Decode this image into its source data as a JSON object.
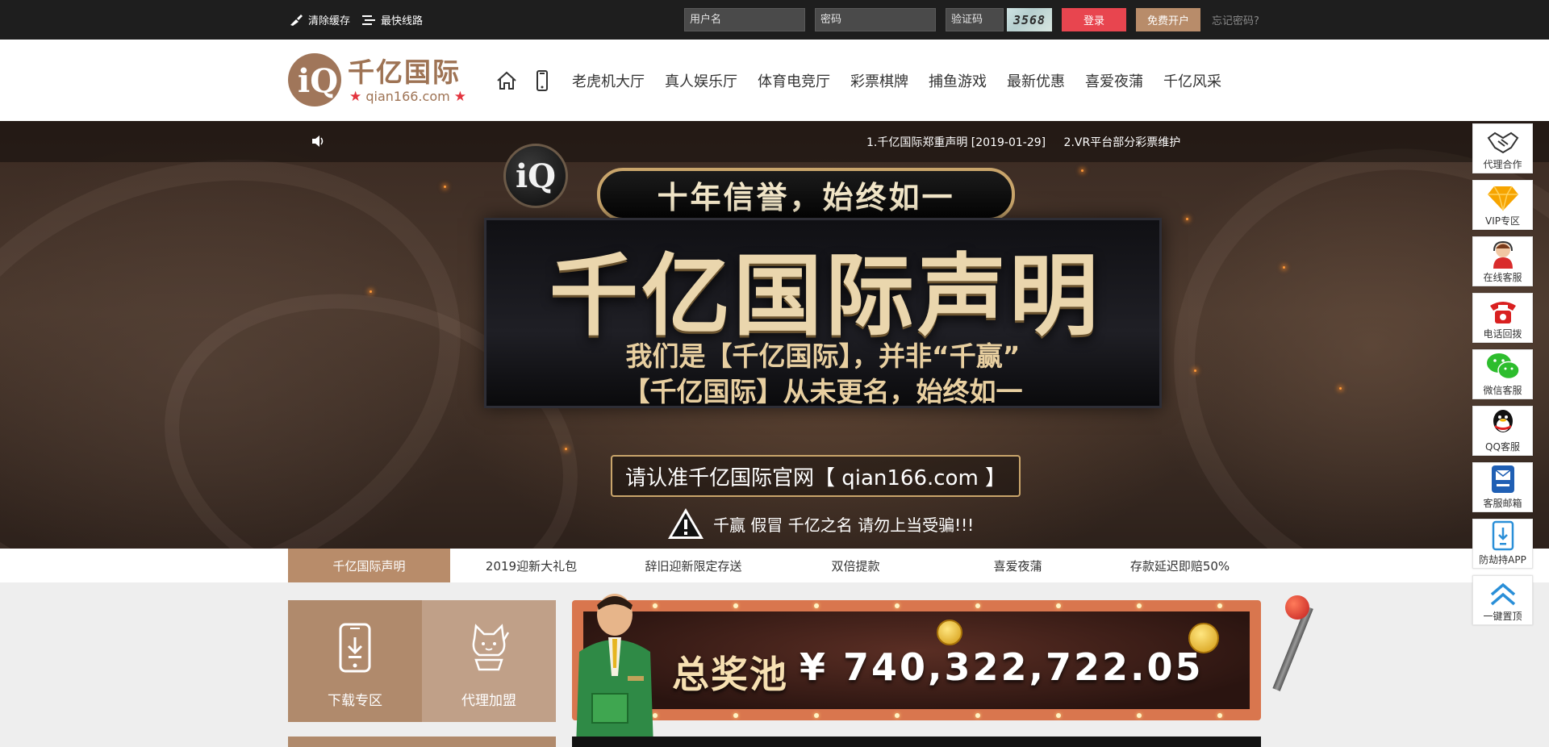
{
  "topbar": {
    "clear_cache": "清除缓存",
    "fastest_route": "最快线路",
    "username_placeholder": "用户名",
    "password_placeholder": "密码",
    "captcha_placeholder": "验证码",
    "captcha_code": "3568",
    "login_label": "登录",
    "register_label": "免费开户",
    "forgot_label": "忘记密码?"
  },
  "header": {
    "logo_name": "千亿国际",
    "logo_domain": "qian166.com",
    "nav": [
      "老虎机大厅",
      "真人娱乐厅",
      "体育电竞厅",
      "彩票棋牌",
      "捕鱼游戏",
      "最新优惠",
      "喜爱夜蒲",
      "千亿风采"
    ]
  },
  "banner": {
    "notices": [
      "1.千亿国际郑重声明 [2019-01-29]",
      "2.VR平台部分彩票维护"
    ],
    "hero_logo": "iQ",
    "hero_top": "十年信誉，始终如一",
    "hero_title": "千亿国际声明",
    "hero_sub_1": "我们是【千亿国际】，并非“千赢”",
    "hero_sub_2": "【千亿国际】从未更名，始终如一",
    "hero_url": "请认准千亿国际官网【 qian166.com 】",
    "hero_warn": "千赢 假冒 千亿之名 请勿上当受骗!!!"
  },
  "tabs": [
    {
      "label": "千亿国际声明",
      "active": true
    },
    {
      "label": "2019迎新大礼包",
      "active": false
    },
    {
      "label": "辞旧迎新限定存送",
      "active": false
    },
    {
      "label": "双倍提款",
      "active": false
    },
    {
      "label": "喜爱夜蒲",
      "active": false
    },
    {
      "label": "存款延迟即赔50%",
      "active": false
    }
  ],
  "tiles": {
    "download": "下载专区",
    "agent": "代理加盟"
  },
  "jackpot": {
    "label": "总奖池",
    "amount": "¥ 740,322,722.05"
  },
  "float_menu": [
    {
      "label": "代理合作",
      "icon": "handshake-icon"
    },
    {
      "label": "VIP专区",
      "icon": "diamond-icon"
    },
    {
      "label": "在线客服",
      "icon": "customer-service-icon"
    },
    {
      "label": "电话回拨",
      "icon": "telephone-icon"
    },
    {
      "label": "微信客服",
      "icon": "wechat-icon"
    },
    {
      "label": "QQ客服",
      "icon": "qq-icon"
    },
    {
      "label": "客服邮箱",
      "icon": "mailbox-icon"
    },
    {
      "label": "防劫持APP",
      "icon": "app-download-icon"
    },
    {
      "label": "一键置顶",
      "icon": "back-to-top-icon"
    }
  ],
  "colors": {
    "accent_brown": "#b88c6a",
    "login_red": "#e8454f",
    "topbar_bg": "#1e1e1e"
  }
}
